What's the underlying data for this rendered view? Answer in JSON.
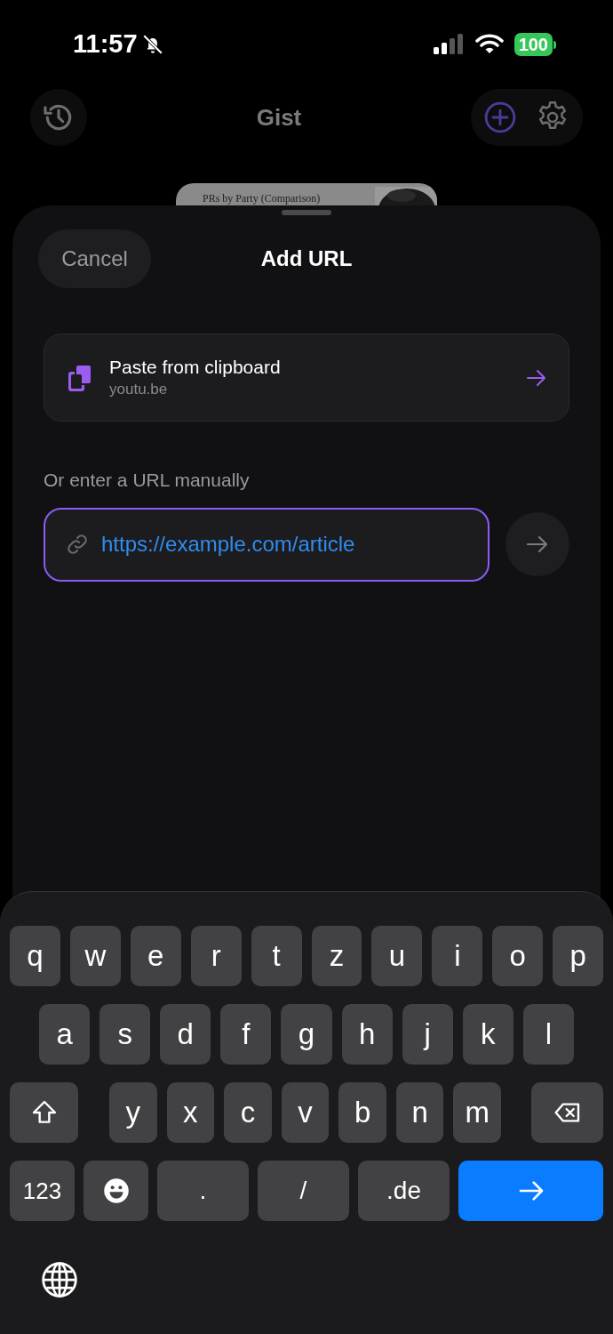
{
  "status_bar": {
    "time": "11:57",
    "battery": "100"
  },
  "header": {
    "title": "Gist"
  },
  "background_card": {
    "title": "PRs by Party (Comparison)"
  },
  "sheet": {
    "cancel": "Cancel",
    "title": "Add URL",
    "paste": {
      "title": "Paste from clipboard",
      "subtitle": "youtu.be"
    },
    "manual_label": "Or enter a URL manually",
    "url_field": {
      "value": "https://example.com/article"
    }
  },
  "keyboard": {
    "rows": [
      {
        "keys": [
          {
            "kind": "char",
            "label": "q"
          },
          {
            "kind": "char",
            "label": "w"
          },
          {
            "kind": "char",
            "label": "e"
          },
          {
            "kind": "char",
            "label": "r"
          },
          {
            "kind": "char",
            "label": "t"
          },
          {
            "kind": "char",
            "label": "z"
          },
          {
            "kind": "char",
            "label": "u"
          },
          {
            "kind": "char",
            "label": "i"
          },
          {
            "kind": "char",
            "label": "o"
          },
          {
            "kind": "char",
            "label": "p"
          }
        ]
      },
      {
        "keys": [
          {
            "kind": "char",
            "label": "a"
          },
          {
            "kind": "char",
            "label": "s"
          },
          {
            "kind": "char",
            "label": "d"
          },
          {
            "kind": "char",
            "label": "f"
          },
          {
            "kind": "char",
            "label": "g"
          },
          {
            "kind": "char",
            "label": "h"
          },
          {
            "kind": "char",
            "label": "j"
          },
          {
            "kind": "char",
            "label": "k"
          },
          {
            "kind": "char",
            "label": "l"
          }
        ]
      },
      {
        "keys": [
          {
            "kind": "shift"
          },
          {
            "kind": "char",
            "label": "y"
          },
          {
            "kind": "char",
            "label": "x"
          },
          {
            "kind": "char",
            "label": "c"
          },
          {
            "kind": "char",
            "label": "v"
          },
          {
            "kind": "char",
            "label": "b"
          },
          {
            "kind": "char",
            "label": "n"
          },
          {
            "kind": "char",
            "label": "m"
          },
          {
            "kind": "delete"
          }
        ]
      },
      {
        "keys": [
          {
            "kind": "mode",
            "label": "123"
          },
          {
            "kind": "emoji"
          },
          {
            "kind": "wide",
            "label": "."
          },
          {
            "kind": "wide",
            "label": "/"
          },
          {
            "kind": "wide",
            "label": ".de"
          },
          {
            "kind": "go"
          }
        ]
      }
    ]
  }
}
